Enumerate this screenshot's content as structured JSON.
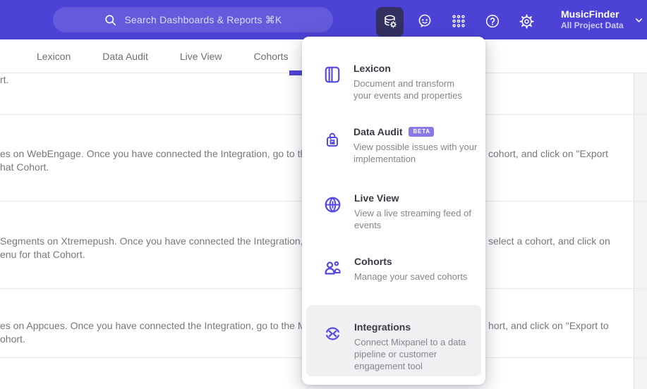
{
  "colors": {
    "topbar_purple": "#4c43d6",
    "active_button_bg": "#343062",
    "accent_underline": "#4c43d6",
    "menu_icon_purple": "#5549e0",
    "beta_badge_purple": "#8b79e8"
  },
  "header": {
    "search": {
      "placeholder": "Search Dashboards & Reports ⌘K"
    },
    "project": {
      "name": "MusicFinder",
      "subtitle": "All Project Data"
    }
  },
  "tabs": {
    "tab1": "Lexicon",
    "tab2": "Data Audit",
    "tab3": "Live View",
    "tab4": "Cohorts"
  },
  "content": {
    "rows": [
      {
        "line1_left": "rt.",
        "line1_right": "",
        "line2": ""
      },
      {
        "line1_left": "es on WebEngage. Once you have connected the Integration, go to the",
        "line1_right": "cohort, and click on \"Export",
        "line2": "hat Cohort."
      },
      {
        "line1_left": "Segments on Xtremepush. Once you have connected the Integration,",
        "line1_right": "select a cohort, and click on",
        "line2": "enu for that Cohort."
      },
      {
        "line1_left": "es on Appcues. Once you have connected the Integration, go to the M",
        "line1_right": "hort, and click on \"Export to",
        "line2": "ohort."
      }
    ]
  },
  "menu": {
    "items": [
      {
        "title": "Lexicon",
        "description": "Document and transform your events and properties"
      },
      {
        "title": "Data Audit",
        "badge": "BETA",
        "description": "View possible issues with your implementation"
      },
      {
        "title": "Live View",
        "description": "View a live streaming feed of events"
      },
      {
        "title": "Cohorts",
        "description": "Manage your saved cohorts"
      },
      {
        "title": "Integrations",
        "description": "Connect Mixpanel to a data pipeline or customer engagement tool"
      }
    ]
  }
}
